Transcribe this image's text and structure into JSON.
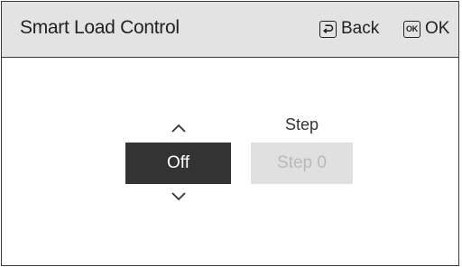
{
  "header": {
    "title": "Smart Load Control",
    "back_label": "Back",
    "ok_icon_text": "OK",
    "ok_label": "OK"
  },
  "control": {
    "value": "Off",
    "up_icon": "chevron-up-icon",
    "down_icon": "chevron-down-icon"
  },
  "step": {
    "label": "Step",
    "value": "Step 0"
  },
  "colors": {
    "header_bg": "#e3e3e3",
    "selected_bg": "#333333",
    "disabled_bg": "#e0e0e0",
    "disabled_text": "#b9b9b9"
  }
}
